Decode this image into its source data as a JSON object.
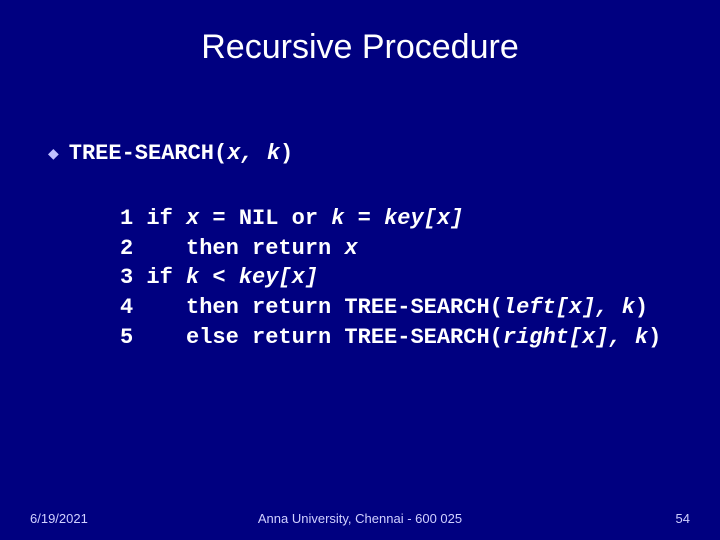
{
  "title": "Recursive Procedure",
  "func": {
    "name": "TREE-SEARCH(",
    "args": "x, k",
    "close": ")"
  },
  "lines": {
    "l1a": "1 if ",
    "l1b": "x",
    "l1c": " = NIL or ",
    "l1d": "k",
    "l1e": " = ",
    "l1f": "key[x]",
    "l2a": "2    then return ",
    "l2b": "x",
    "l3a": "3 if ",
    "l3b": "k",
    "l3c": " < ",
    "l3d": "key[x]",
    "l4a": "4    then return TREE-SEARCH(",
    "l4b": "left[x], k",
    "l4c": ")",
    "l5a": "5    else return TREE-SEARCH(",
    "l5b": "right[x], k",
    "l5c": ")"
  },
  "footer": {
    "date": "6/19/2021",
    "center": "Anna University, Chennai - 600 025",
    "page": "54"
  }
}
